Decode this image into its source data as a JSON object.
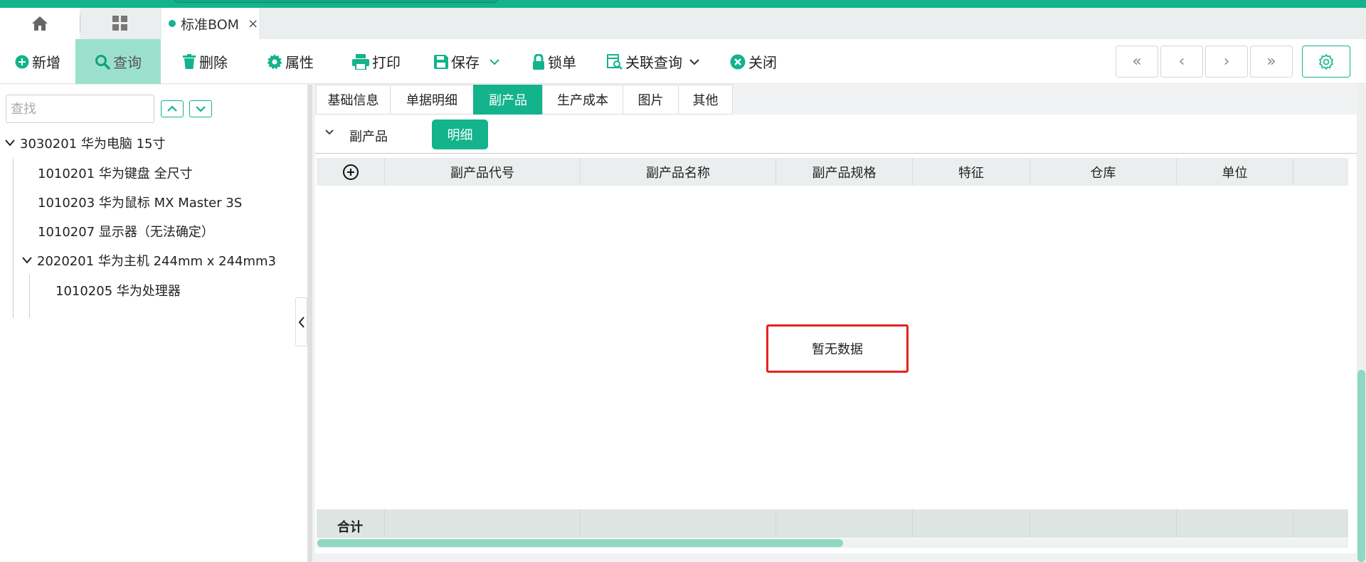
{
  "colors": {
    "accent": "#13b38b",
    "accent_light": "#9be0cd",
    "highlight": "#e5231d"
  },
  "tabs": {
    "home_icon": "home-icon",
    "apps_icon": "grid-icon",
    "doc_title": "标准BOM",
    "close_symbol": "×"
  },
  "toolbar": {
    "new_label": "新增",
    "query_label": "查询",
    "delete_label": "删除",
    "properties_label": "属性",
    "print_label": "打印",
    "save_label": "保存",
    "lock_label": "锁单",
    "related_query_label": "关联查询",
    "close_label": "关闭"
  },
  "nav": {
    "first": "«",
    "prev": "‹",
    "next": "›",
    "last": "»"
  },
  "tree": {
    "search_placeholder": "查找",
    "items": [
      {
        "label": "3030201 华为电脑 15寸"
      },
      {
        "label": "1010201 华为键盘 全尺寸"
      },
      {
        "label": "1010203 华为鼠标 MX Master 3S"
      },
      {
        "label": "1010207 显示器（无法确定）"
      },
      {
        "label": "2020201 华为主机 244mm x 244mm3"
      },
      {
        "label": "1010205 华为处理器"
      }
    ]
  },
  "subtabs": {
    "items": [
      {
        "label": "基础信息"
      },
      {
        "label": "单据明细"
      },
      {
        "label": "副产品"
      },
      {
        "label": "生产成本"
      },
      {
        "label": "图片"
      },
      {
        "label": "其他"
      }
    ],
    "active": "副产品"
  },
  "section": {
    "title": "副产品",
    "detail_button": "明细"
  },
  "grid": {
    "columns": [
      "副产品代号",
      "副产品名称",
      "副产品规格",
      "特征",
      "仓库",
      "单位"
    ],
    "empty_text": "暂无数据",
    "footer_label": "合计"
  }
}
